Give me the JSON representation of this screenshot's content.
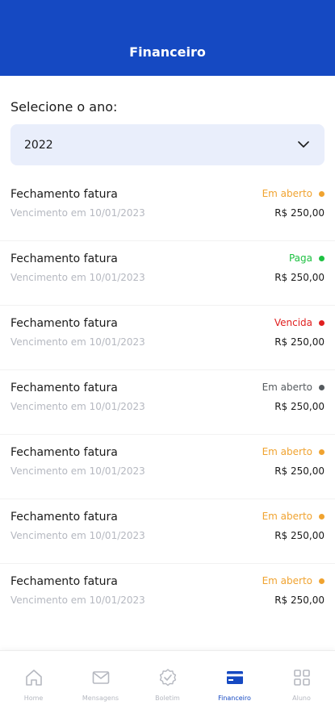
{
  "header": {
    "title": "Financeiro",
    "color": "#1549c2"
  },
  "year": {
    "label": "Selecione o ano:",
    "selected": "2022"
  },
  "invoices": [
    {
      "name": "Fechamento fatura",
      "due": "Vencimento em 10/01/2023",
      "status": "Em aberto",
      "status_color": "#f0a330",
      "amount": "R$ 250,00"
    },
    {
      "name": "Fechamento fatura",
      "due": "Vencimento em 10/01/2023",
      "status": "Paga",
      "status_color": "#1ec142",
      "amount": "R$ 250,00"
    },
    {
      "name": "Fechamento fatura",
      "due": "Vencimento em 10/01/2023",
      "status": "Vencida",
      "status_color": "#e01f1f",
      "amount": "R$ 250,00"
    },
    {
      "name": "Fechamento fatura",
      "due": "Vencimento em 10/01/2023",
      "status": "Em aberto",
      "status_color": "#555a5e",
      "amount": "R$ 250,00"
    },
    {
      "name": "Fechamento fatura",
      "due": "Vencimento em 10/01/2023",
      "status": "Em aberto",
      "status_color": "#f0a330",
      "amount": "R$ 250,00"
    },
    {
      "name": "Fechamento fatura",
      "due": "Vencimento em 10/01/2023",
      "status": "Em aberto",
      "status_color": "#f0a330",
      "amount": "R$ 250,00"
    },
    {
      "name": "Fechamento fatura",
      "due": "Vencimento em 10/01/2023",
      "status": "Em aberto",
      "status_color": "#f0a330",
      "amount": "R$ 250,00"
    }
  ],
  "nav": {
    "items": [
      {
        "label": "Home",
        "icon": "home-icon"
      },
      {
        "label": "Mensagens",
        "icon": "mail-icon"
      },
      {
        "label": "Boletim",
        "icon": "badge-check-icon"
      },
      {
        "label": "Financeiro",
        "icon": "wallet-icon",
        "active": true
      },
      {
        "label": "Aluno",
        "icon": "grid-icon"
      }
    ],
    "active_color": "#1549c2",
    "inactive_color": "#b5b8c0"
  }
}
